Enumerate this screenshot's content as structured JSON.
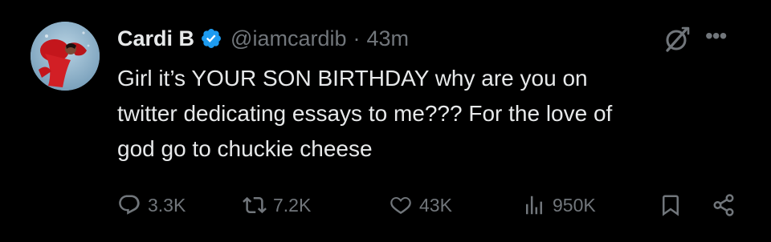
{
  "tweet": {
    "author": {
      "display_name": "Cardi B",
      "handle": "@iamcardib",
      "verified": true
    },
    "separator": "·",
    "time": "43m",
    "text_lines": [
      "Girl it’s YOUR SON BIRTHDAY why are you on",
      "twitter dedicating essays to me??? For the love of",
      "god go to chuckie cheese"
    ],
    "more_label": "•••",
    "stats": {
      "replies": "3.3K",
      "retweets": "7.2K",
      "likes": "43K",
      "views": "950K"
    }
  },
  "colors": {
    "background": "#000000",
    "primary_text": "#e7e9ea",
    "secondary_text": "#71767b",
    "verified_badge": "#1d9bf0"
  },
  "icons": {
    "verified": "verified-badge-icon",
    "grok": "grok-icon",
    "more": "more-options-icon",
    "reply": "reply-icon",
    "retweet": "retweet-icon",
    "like": "heart-icon",
    "views": "views-chart-icon",
    "bookmark": "bookmark-icon",
    "share": "share-icon"
  }
}
